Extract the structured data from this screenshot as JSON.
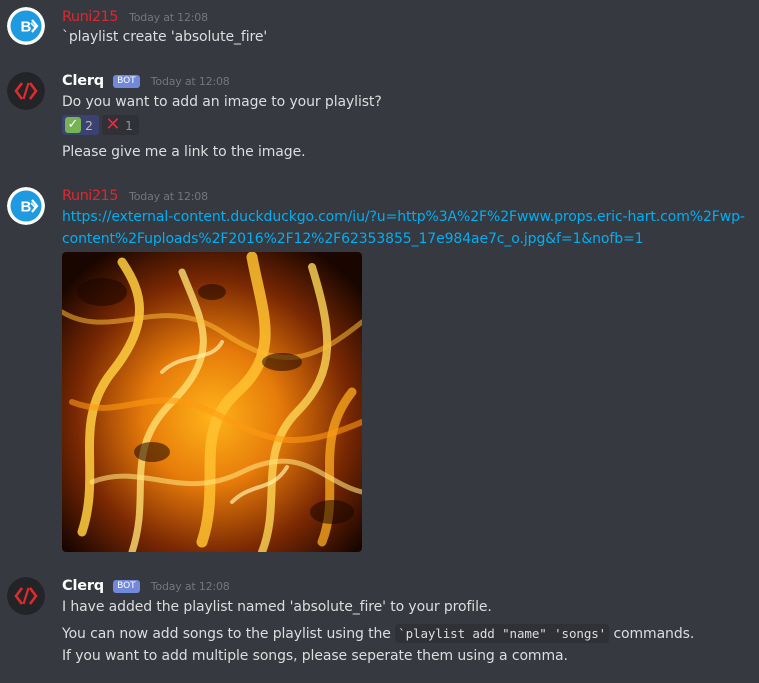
{
  "colors": {
    "background": "#36393f",
    "user_name": "#e0262f",
    "bot_name": "#ffffff",
    "bot_tag": "#7289da",
    "link": "#00aff4",
    "timestamp": "#72767d"
  },
  "messages": [
    {
      "author": "Runi215",
      "timestamp": "Today at 12:08",
      "avatar_icon": "runi-avatar-icon",
      "lines": [
        "`playlist create 'absolute_fire'"
      ]
    },
    {
      "author": "Clerq",
      "bot_tag": "BOT",
      "timestamp": "Today at 12:08",
      "avatar_icon": "clerq-code-avatar-icon",
      "lines": [
        "Do you want to add an image to your playlist?"
      ],
      "reactions": [
        {
          "emoji": "white-check-mark-icon",
          "count": "2"
        },
        {
          "emoji": "cross-mark-icon",
          "count": "1"
        }
      ],
      "followup": "Please give me a link to the image."
    },
    {
      "author": "Runi215",
      "timestamp": "Today at 12:08",
      "avatar_icon": "runi-avatar-icon",
      "link": "https://external-content.duckduckgo.com/iu/?u=http%3A%2F%2Fwww.props.eric-hart.com%2Fwp-content%2Fuploads%2F2016%2F12%2F62353855_17e984ae7c_o.jpg&f=1&nofb=1",
      "image": "fire-flames-image"
    },
    {
      "author": "Clerq",
      "bot_tag": "BOT",
      "timestamp": "Today at 12:08",
      "avatar_icon": "clerq-code-avatar-icon",
      "lines": [
        "I have added the playlist named 'absolute_fire' to your profile.",
        "If you want to add multiple songs, please seperate them using a comma."
      ],
      "songs_line": {
        "before": "You can now add songs to the playlist using the ",
        "code": "`playlist add \"name\" 'songs'",
        "after": " commands."
      }
    }
  ]
}
